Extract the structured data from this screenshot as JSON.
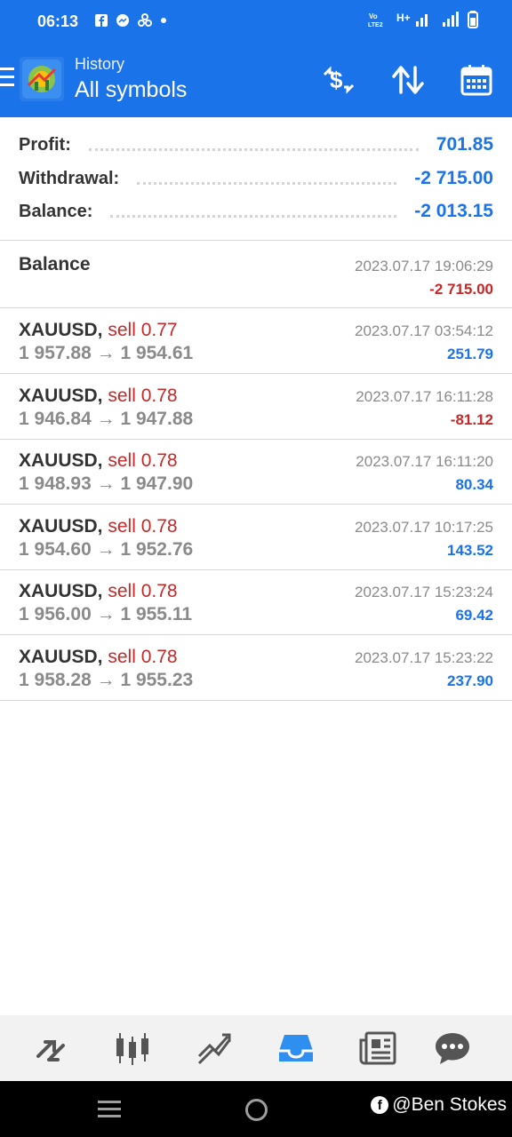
{
  "status_bar": {
    "time": "06:13",
    "left_icons": [
      "facebook-icon",
      "messenger-icon",
      "network-icon",
      "dot-icon"
    ],
    "right_icons": [
      "volte-icon",
      "hplus-icon",
      "signal-icon",
      "signal-icon",
      "battery-icon"
    ]
  },
  "header": {
    "subtitle": "History",
    "title": "All symbols",
    "actions": [
      "dollar-exchange-icon",
      "sort-icon",
      "calendar-icon"
    ]
  },
  "summary": {
    "profit_label": "Profit:",
    "profit_value": "701.85",
    "withdrawal_label": "Withdrawal:",
    "withdrawal_value": "-2 715.00",
    "balance_label": "Balance:",
    "balance_value": "-2 013.15"
  },
  "balance_entry": {
    "label": "Balance",
    "date": "2023.07.17 19:06:29",
    "amount": "-2 715.00"
  },
  "deals": [
    {
      "symbol": "XAUUSD,",
      "side": "sell 0.77",
      "open": "1 957.88",
      "close": "1 954.61",
      "date": "2023.07.17 03:54:12",
      "profit": "251.79",
      "positive": true
    },
    {
      "symbol": "XAUUSD,",
      "side": "sell 0.78",
      "open": "1 946.84",
      "close": "1 947.88",
      "date": "2023.07.17 16:11:28",
      "profit": "-81.12",
      "positive": false
    },
    {
      "symbol": "XAUUSD,",
      "side": "sell 0.78",
      "open": "1 948.93",
      "close": "1 947.90",
      "date": "2023.07.17 16:11:20",
      "profit": "80.34",
      "positive": true
    },
    {
      "symbol": "XAUUSD,",
      "side": "sell 0.78",
      "open": "1 954.60",
      "close": "1 952.76",
      "date": "2023.07.17 10:17:25",
      "profit": "143.52",
      "positive": true
    },
    {
      "symbol": "XAUUSD,",
      "side": "sell 0.78",
      "open": "1 956.00",
      "close": "1 955.11",
      "date": "2023.07.17 15:23:24",
      "profit": "69.42",
      "positive": true
    },
    {
      "symbol": "XAUUSD,",
      "side": "sell 0.78",
      "open": "1 958.28",
      "close": "1 955.23",
      "date": "2023.07.17 15:23:22",
      "profit": "237.90",
      "positive": true
    }
  ],
  "arrow": "→",
  "bottom_nav": [
    "quotes-icon",
    "chart-icon",
    "trade-icon",
    "history-icon",
    "news-icon",
    "chat-icon"
  ],
  "active_nav": "history-icon",
  "watermark": "@Ben Stokes",
  "colors": {
    "primary": "#1a73e8",
    "negative": "#c62828",
    "muted": "#8a8a8a"
  }
}
